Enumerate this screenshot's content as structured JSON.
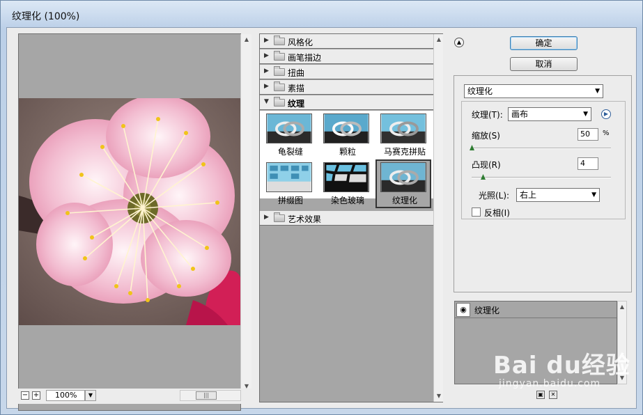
{
  "window": {
    "title": "纹理化 (100%)"
  },
  "preview": {
    "zoom_value": "100%"
  },
  "gallery": {
    "categories": [
      {
        "label": "风格化",
        "expanded": false
      },
      {
        "label": "画笔描边",
        "expanded": false
      },
      {
        "label": "扭曲",
        "expanded": false
      },
      {
        "label": "素描",
        "expanded": false
      },
      {
        "label": "纹理",
        "expanded": true
      },
      {
        "label": "艺术效果",
        "expanded": false
      }
    ],
    "texture_filters": [
      "龟裂缝",
      "颗粒",
      "马赛克拼贴",
      "拼缀图",
      "染色玻璃",
      "纹理化"
    ],
    "selected_filter": "纹理化"
  },
  "buttons": {
    "ok": "确定",
    "cancel": "取消"
  },
  "settings": {
    "filter_select": "纹理化",
    "texture_label": "纹理(T):",
    "texture_value": "画布",
    "scaling_label": "缩放(S)",
    "scaling_value": "50",
    "scaling_unit": "%",
    "scaling_fraction": 0.0,
    "relief_label": "凸现(R)",
    "relief_value": "4",
    "relief_fraction": 0.08,
    "light_label": "光照(L):",
    "light_value": "右上",
    "invert_label": "反相(I)",
    "invert_checked": false
  },
  "layers": {
    "items": [
      "纹理化"
    ]
  },
  "watermark": {
    "brand": "Bai du经验",
    "sub": "jingyan.baidu.com"
  }
}
